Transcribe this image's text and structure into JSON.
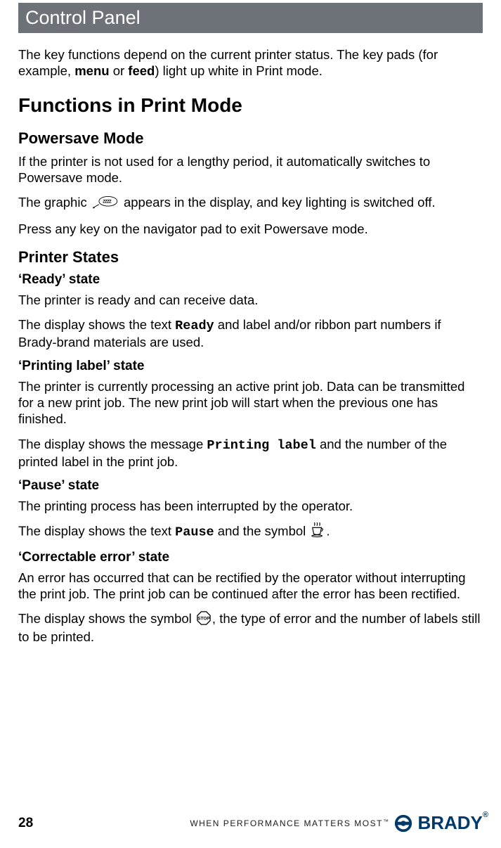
{
  "header": {
    "title": "Control Panel"
  },
  "intro": {
    "t1": "The key functions depend on the current printer status. The key pads (for example, ",
    "b1": "menu",
    "t2": " or ",
    "b2": "feed",
    "t3": ") light up white in Print mode."
  },
  "section1": {
    "title": "Functions in Print Mode"
  },
  "powersave": {
    "title": "Powersave Mode",
    "p1": "If the printer is not used for a lengthy period, it automatically switches to Powersave mode.",
    "p2a": "The graphic ",
    "p2b": " appears in the display, and key lighting is switched off.",
    "p3": "Press any key on the navigator pad to exit Powersave mode."
  },
  "printer_states": {
    "title": "Printer States",
    "ready": {
      "title": "‘Ready’ state",
      "p1": "The printer is ready and can receive data.",
      "p2a": "The display shows the text ",
      "p2m": "Ready",
      "p2b": " and label and/or ribbon part numbers if Brady-brand materials are used."
    },
    "printing": {
      "title": "‘Printing label’ state",
      "p1": "The printer is currently processing an active print job. Data can be transmitted for a new print job. The new print job will start when the previous one has finished.",
      "p2a": "The display shows the message ",
      "p2m": "Printing label",
      "p2b": " and the number of the printed label in the print job."
    },
    "pause": {
      "title": "‘Pause’ state",
      "p1": "The printing process has been interrupted by the operator.",
      "p2a": "The display shows the text ",
      "p2m": "Pause",
      "p2b": " and the symbol ",
      "p2c": "."
    },
    "correctable": {
      "title": "‘Correctable error’ state",
      "p1": "An error has occurred that can be rectified by the operator without interrupting the print job. The print job can be continued after the error has been rectified.",
      "p2a": "The display shows the symbol ",
      "p2b": ", the type of error and the number of labels still to be printed."
    }
  },
  "footer": {
    "page": "28",
    "tagline": "WHEN PERFORMANCE MATTERS MOST",
    "brand": "BRADY",
    "tm": "™",
    "reg": "®"
  }
}
